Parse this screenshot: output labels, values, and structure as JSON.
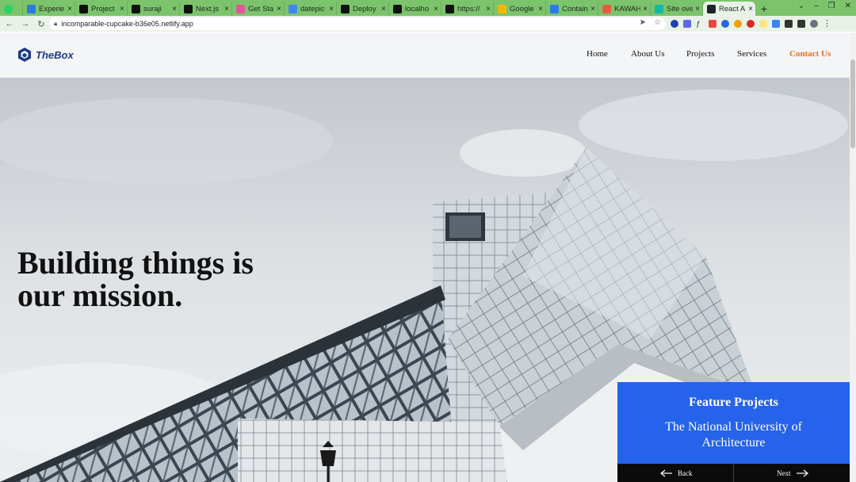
{
  "browser": {
    "tabs": [
      {
        "title": "Experie",
        "favicon_color": "#2a7ae2"
      },
      {
        "title": "Project",
        "favicon_color": "#111111"
      },
      {
        "title": "suraji",
        "favicon_color": "#111111"
      },
      {
        "title": "Next.js",
        "favicon_color": "#111111"
      },
      {
        "title": "Get Sta",
        "favicon_color": "#e0569c"
      },
      {
        "title": "datepic",
        "favicon_color": "#4285f4"
      },
      {
        "title": "Deploy",
        "favicon_color": "#111111"
      },
      {
        "title": "localho",
        "favicon_color": "#111111"
      },
      {
        "title": "https://",
        "favicon_color": "#111111"
      },
      {
        "title": "Google",
        "favicon_color": "#f2b705"
      },
      {
        "title": "Contain",
        "favicon_color": "#2c7be5"
      },
      {
        "title": "KAWAH",
        "favicon_color": "#e85d3f"
      },
      {
        "title": "Site ove",
        "favicon_color": "#14b8a6"
      },
      {
        "title": "React A",
        "favicon_color": "#20232a"
      }
    ],
    "active_tab_index": 13,
    "url": "incomparable-cupcake-b36e05.netlify.app"
  },
  "site": {
    "brand": "TheBox",
    "brand_color": "#1e3a8a",
    "accent_color": "#ea6d1f",
    "nav": [
      {
        "label": "Home"
      },
      {
        "label": "About Us"
      },
      {
        "label": "Projects"
      },
      {
        "label": "Services"
      },
      {
        "label": "Contact Us",
        "highlighted": true
      }
    ],
    "hero": {
      "title": "Building things is our mission."
    },
    "feature": {
      "heading": "Feature Projects",
      "project_name": "The National University of Architecture",
      "panel_color": "#2563eb",
      "back_label": "Back",
      "next_label": "Next"
    }
  }
}
